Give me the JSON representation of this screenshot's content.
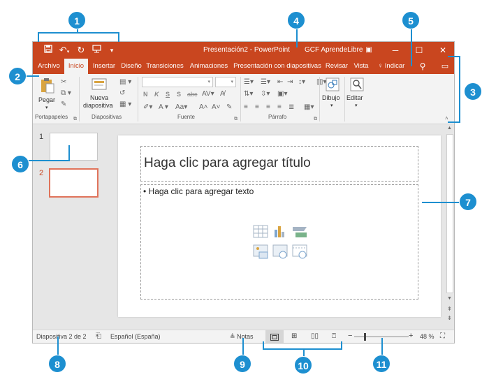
{
  "window": {
    "title": "Presentación2  -  PowerPoint",
    "user": "GCF AprendeLibre",
    "accent": "#c9461f"
  },
  "quick_access": {
    "save_icon": "save-icon",
    "undo_icon": "undo-icon",
    "redo_icon": "redo-icon",
    "present_icon": "present-from-start-icon",
    "customize_icon": "customize-arrow-icon"
  },
  "tabs": [
    "Archivo",
    "Inicio",
    "Insertar",
    "Diseño",
    "Transiciones",
    "Animaciones",
    "Presentación con diapositivas",
    "Revisar",
    "Vista"
  ],
  "active_tab": "Inicio",
  "tell_me": "Indicar",
  "ribbon": {
    "paste_label": "Pegar",
    "new_slide_label_1": "Nueva",
    "new_slide_label_2": "diapositiva",
    "bold": "N",
    "italic": "K",
    "underline": "S",
    "shadow": "S",
    "strike": "abc",
    "draw_label": "Dibujo",
    "edit_label": "Editar",
    "groups": {
      "clipboard": "Portapapeles",
      "slides": "Diapositivas",
      "font": "Fuente",
      "paragraph": "Párrafo"
    }
  },
  "thumbnails": [
    {
      "number": "1",
      "selected": false
    },
    {
      "number": "2",
      "selected": true
    }
  ],
  "slide": {
    "title_placeholder": "Haga clic para agregar título",
    "content_placeholder": "• Haga clic para agregar texto"
  },
  "status": {
    "slide_info": "Diapositiva 2 de 2",
    "language": "Español (España)",
    "notes": "Notas",
    "zoom": "48 %",
    "zoom_minus": "−",
    "zoom_plus": "+"
  },
  "callouts": [
    "1",
    "2",
    "3",
    "4",
    "5",
    "6",
    "7",
    "8",
    "9",
    "10",
    "11"
  ],
  "callout_color": "#1d8fd0"
}
